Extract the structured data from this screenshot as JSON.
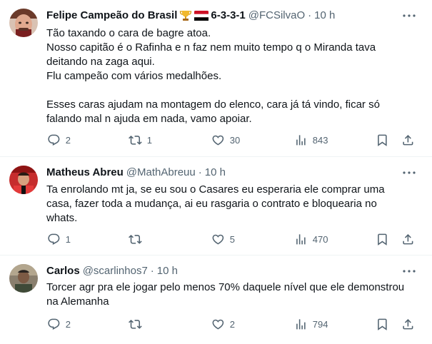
{
  "tweets": [
    {
      "name": "Felipe Campeão do Brasil",
      "badges": "6-3-3-1",
      "handle": "@FCSilvaO",
      "separator": "·",
      "time": "10 h",
      "lines": [
        "Tão taxando o cara de bagre atoa.",
        "Nosso capitão é o Rafinha e n faz nem muito tempo q o Miranda tava",
        "deitando na zaga aqui.",
        "Flu campeão com vários medalhões.",
        "",
        "Esses caras ajudam na montagem do elenco, cara já tá vindo, ficar só",
        "falando mal n ajuda em nada, vamo apoiar."
      ],
      "replies": "2",
      "retweets": "1",
      "likes": "30",
      "views": "843"
    },
    {
      "name": "Matheus Abreu",
      "handle": "@MathAbreuu",
      "separator": "·",
      "time": "10 h",
      "lines": [
        "Ta enrolando mt ja, se eu sou o Casares eu esperaria ele comprar uma",
        "casa, fazer toda a mudança, ai eu rasgaria o contrato e bloquearia no",
        "whats."
      ],
      "replies": "1",
      "retweets": "",
      "likes": "5",
      "views": "470"
    },
    {
      "name": "Carlos",
      "handle": "@scarlinhos7",
      "separator": "·",
      "time": "10 h",
      "lines": [
        "Torcer agr pra ele jogar pelo menos 70% daquele nível que ele demonstrou",
        "na Alemanha"
      ],
      "replies": "2",
      "retweets": "",
      "likes": "2",
      "views": "794"
    }
  ],
  "colors": {
    "text": "#0f1419",
    "secondary": "#536471",
    "divider": "#eff3f4"
  },
  "icons": [
    "more-icon",
    "reply-icon",
    "retweet-icon",
    "like-icon",
    "views-icon",
    "bookmark-icon",
    "share-icon",
    "trophy-icon",
    "flag-icon"
  ]
}
